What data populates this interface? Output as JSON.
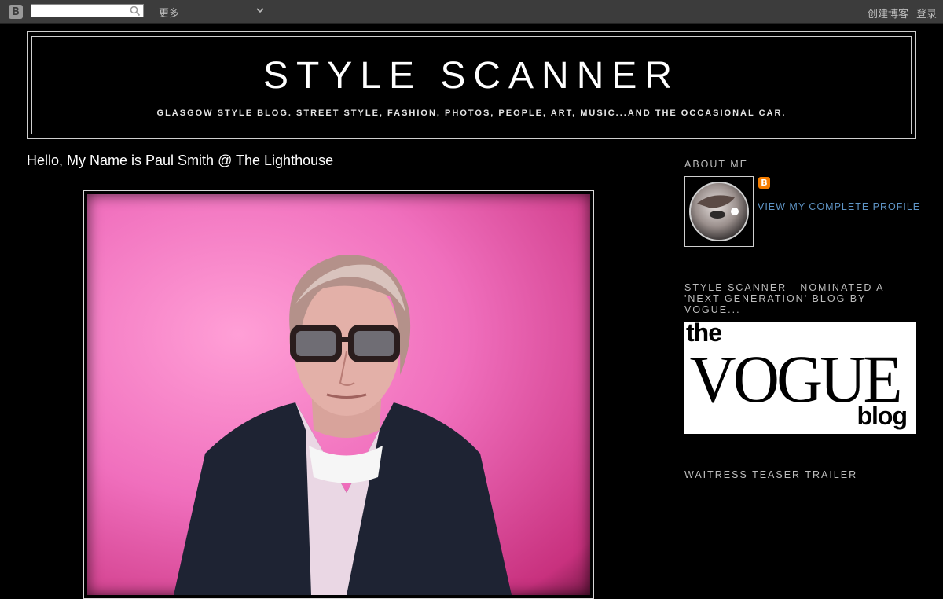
{
  "navbar": {
    "logo_letter": "B",
    "search": {
      "value": "",
      "placeholder": ""
    },
    "more_label": "更多",
    "create_blog": "创建博客",
    "login": "登录"
  },
  "header": {
    "title": "STYLE SCANNER",
    "description": "GLASGOW STYLE BLOG. STREET STYLE, FASHION, PHOTOS, PEOPLE, ART, MUSIC...AND THE OCCASIONAL CAR."
  },
  "post": {
    "title": "Hello, My Name is Paul Smith @ The Lighthouse"
  },
  "sidebar": {
    "about": {
      "heading": "ABOUT ME",
      "badge": "B",
      "profile_link": "VIEW MY COMPLETE PROFILE"
    },
    "vogue": {
      "heading": "STYLE SCANNER - NOMINATED A 'NEXT GENERATION' BLOG BY VOGUE...",
      "logo_the": "the",
      "logo_vogue": "VOGUE",
      "logo_blog": "blog"
    },
    "trailer": {
      "heading": "WAITRESS TEASER TRAILER"
    }
  },
  "colors": {
    "background": "#000000",
    "navbar": "#3c3c3c",
    "link": "#5f95c6",
    "blogger_orange": "#f57d00",
    "photo_pink": "#f06fbd"
  }
}
